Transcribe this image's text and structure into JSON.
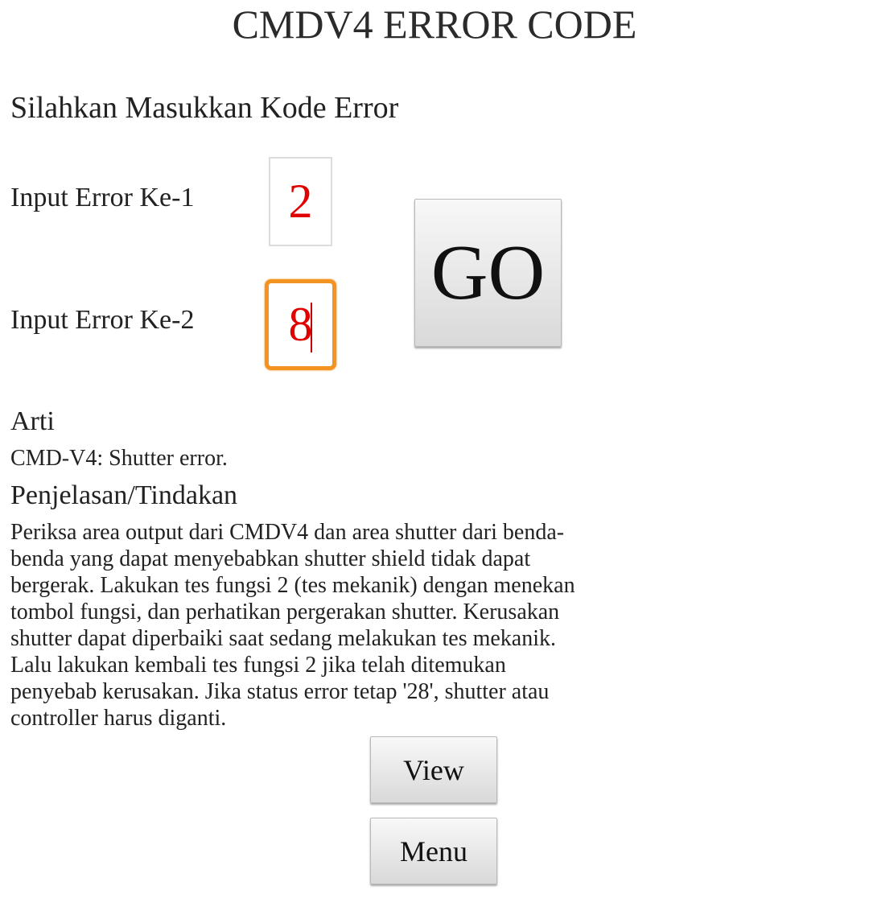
{
  "app": {
    "title": "CMDV4 ERROR CODE"
  },
  "form": {
    "prompt": "Silahkan Masukkan Kode Error",
    "input_1": {
      "label": "Input Error Ke-1",
      "value": "2"
    },
    "input_2": {
      "label": "Input Error Ke-2",
      "value": "8"
    },
    "go_label": "GO"
  },
  "result": {
    "arti_heading": "Arti",
    "arti_text": "CMD-V4: Shutter error.",
    "penjelasan_heading": "Penjelasan/Tindakan",
    "penjelasan_text": "Periksa area output dari CMDV4 dan area shutter dari benda-benda yang dapat menyebabkan shutter shield tidak dapat bergerak. Lakukan tes fungsi 2 (tes mekanik) dengan menekan tombol fungsi, dan perhatikan pergerakan shutter. Kerusakan shutter dapat diperbaiki saat sedang melakukan tes mekanik. Lalu lakukan kembali tes fungsi 2 jika telah ditemukan penyebab kerusakan. Jika status error tetap '28', shutter atau controller harus diganti."
  },
  "actions": {
    "view_label": "View",
    "menu_label": "Menu"
  },
  "colors": {
    "input_text": "#e00000",
    "focus_border": "#f39322"
  }
}
